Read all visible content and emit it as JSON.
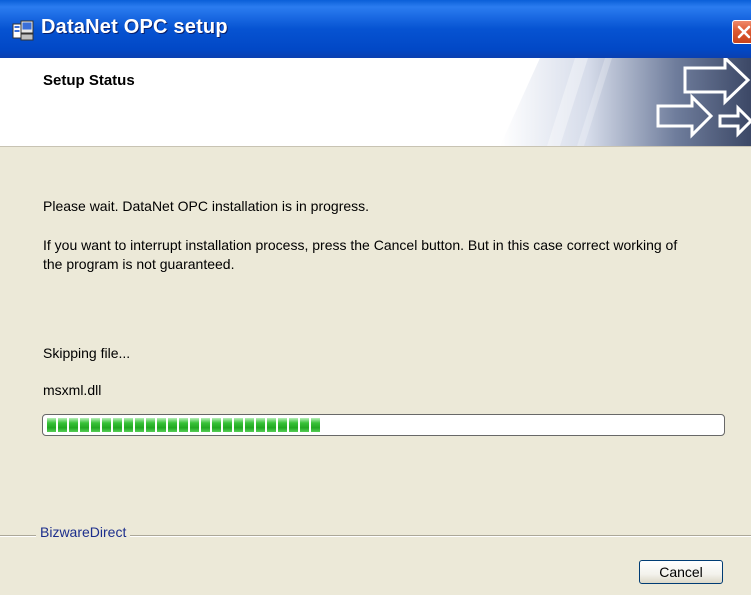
{
  "window": {
    "title": "DataNet OPC setup",
    "title_icon": "setup-icon",
    "close_icon": "close-icon"
  },
  "banner": {
    "title": "Setup Status",
    "art": "arrows-banner"
  },
  "body": {
    "message1": "Please wait. DataNet OPC installation is in progress.",
    "message2": "If you want to interrupt installation process, press the Cancel button. But in this case correct working of the program is not guaranteed.",
    "status": "Skipping file...",
    "filename": "msxml.dll",
    "progress_fraction": 0.41
  },
  "footer": {
    "brand": "BizwareDirect",
    "cancel_label": "Cancel"
  },
  "colors": {
    "titlebar": "#0653d2",
    "background": "#ece9d8",
    "progress": "#22a822",
    "brand_text": "#1c2e8c"
  }
}
